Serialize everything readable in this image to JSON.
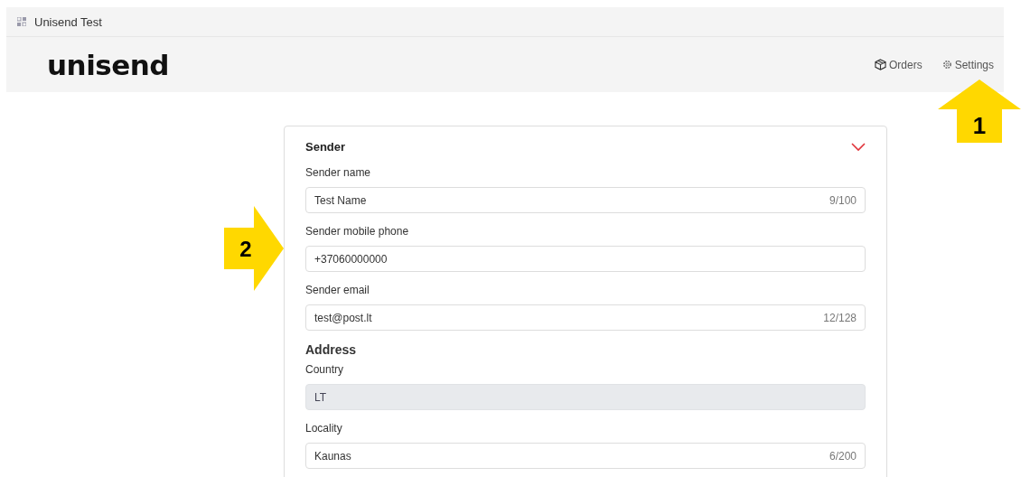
{
  "tab": {
    "title": "Unisend Test"
  },
  "header": {
    "logo": "unisend",
    "nav": [
      {
        "label": "Orders"
      },
      {
        "label": "Settings"
      }
    ]
  },
  "form": {
    "title": "Sender",
    "expanded": true,
    "items": [
      {
        "kind": "field",
        "label": "Sender name",
        "value": "Test Name",
        "counter": "9/100",
        "disabled": false
      },
      {
        "kind": "field",
        "label": "Sender mobile phone",
        "value": "+37060000000",
        "disabled": false
      },
      {
        "kind": "field",
        "label": "Sender email",
        "value": "test@post.lt",
        "counter": "12/128",
        "disabled": false
      },
      {
        "kind": "heading",
        "label": "Address"
      },
      {
        "kind": "field",
        "label": "Country",
        "value": "LT",
        "disabled": true
      },
      {
        "kind": "field",
        "label": "Locality",
        "value": "Kaunas",
        "counter": "6/200",
        "disabled": false
      }
    ]
  },
  "annotations": [
    {
      "number": "1"
    },
    {
      "number": "2"
    }
  ]
}
